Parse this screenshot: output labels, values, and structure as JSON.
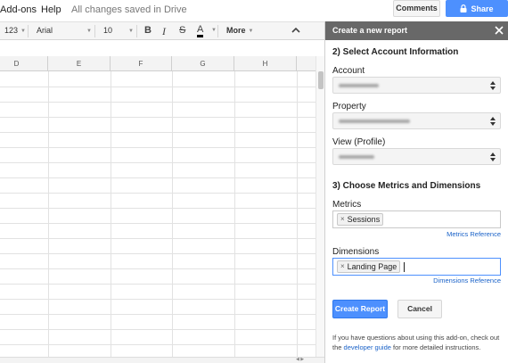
{
  "menubar": {
    "items": [
      "Add-ons",
      "Help"
    ],
    "save_status": "All changes saved in Drive",
    "comments_label": "Comments",
    "share_label": "Share"
  },
  "toolbar": {
    "format_label": "123",
    "font_family": "Arial",
    "font_size": "10",
    "bold": "B",
    "italic": "I",
    "strikethrough": "S",
    "text_color": "A",
    "more_label": "More"
  },
  "sheet": {
    "columns": [
      "D",
      "E",
      "F",
      "G",
      "H"
    ]
  },
  "panel": {
    "title": "Create a new report",
    "section_account": "2) Select Account Information",
    "account_label": "Account",
    "property_label": "Property",
    "view_label": "View (Profile)",
    "section_metrics": "3) Choose Metrics and Dimensions",
    "metrics_label": "Metrics",
    "metrics_tokens": [
      "Sessions"
    ],
    "metrics_reference": "Metrics Reference",
    "dimensions_label": "Dimensions",
    "dimensions_tokens": [
      "Landing Page"
    ],
    "dimensions_reference": "Dimensions Reference",
    "create_label": "Create Report",
    "cancel_label": "Cancel",
    "help_prefix": "If you have questions about using this add-on, check out the",
    "help_link": "developer guide",
    "help_suffix": "for more detailed instructions."
  },
  "colors": {
    "accent": "#4d90fe",
    "panel_header": "#686868",
    "link": "#1a62c8"
  }
}
